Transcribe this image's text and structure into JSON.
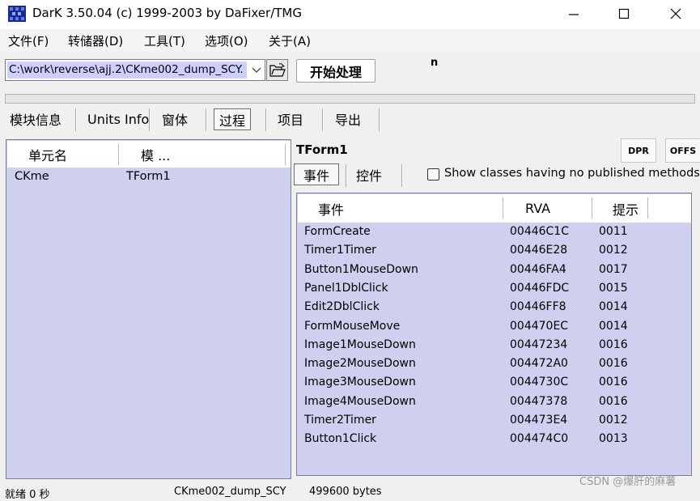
{
  "window": {
    "title": "DarK 3.50.04 (c) 1999-2003 by DaFixer/TMG"
  },
  "menu": [
    "文件(F)",
    "转储器(D)",
    "工具(T)",
    "选项(O)",
    "关于(A)"
  ],
  "toolbar": {
    "path_value": "C:\\work\\reverse\\ajj.2\\CKme002_dump_SCY.",
    "process_label": "开始处理",
    "n_label": "n"
  },
  "tabs": [
    "模块信息",
    "Units Info",
    "窗体",
    "过程",
    "项目",
    "导出"
  ],
  "active_tab": "过程",
  "left_table": {
    "headers": [
      "单元名",
      "模 ..."
    ],
    "rows": [
      {
        "unit": "CKme",
        "module": "TForm1"
      }
    ]
  },
  "right": {
    "form_title": "TForm1",
    "dpr_label": "DPR",
    "offs_label": "OFFS",
    "subtabs": [
      "事件",
      "控件"
    ],
    "checkbox_label": "Show classes having no published methods",
    "checkbox_checked": false
  },
  "events_table": {
    "headers": [
      "事件",
      "RVA",
      "提示"
    ],
    "rows": [
      {
        "event": "FormCreate",
        "rva": "00446C1C",
        "hint": "0011"
      },
      {
        "event": "Timer1Timer",
        "rva": "00446E28",
        "hint": "0012"
      },
      {
        "event": "Button1MouseDown",
        "rva": "00446FA4",
        "hint": "0017"
      },
      {
        "event": "Panel1DblClick",
        "rva": "00446FDC",
        "hint": "0015"
      },
      {
        "event": "Edit2DblClick",
        "rva": "00446FF8",
        "hint": "0014"
      },
      {
        "event": "FormMouseMove",
        "rva": "004470EC",
        "hint": "0014"
      },
      {
        "event": "Image1MouseDown",
        "rva": "00447234",
        "hint": "0016"
      },
      {
        "event": "Image2MouseDown",
        "rva": "004472A0",
        "hint": "0016"
      },
      {
        "event": "Image3MouseDown",
        "rva": "0044730C",
        "hint": "0016"
      },
      {
        "event": "Image4MouseDown",
        "rva": "00447378",
        "hint": "0016"
      },
      {
        "event": "Timer2Timer",
        "rva": "004473E4",
        "hint": "0012"
      },
      {
        "event": "Button1Click",
        "rva": "004474C0",
        "hint": "0013"
      }
    ]
  },
  "status": {
    "left": "就绪 0 秒",
    "middle": "CKme002_dump_SCY",
    "right": "499600 bytes"
  },
  "watermark": "CSDN @爆肝的麻薯",
  "colors": {
    "list_background": "#cfcfef",
    "selection": "#cfcfff"
  },
  "icons": [
    "app-icon",
    "minimize-icon",
    "maximize-icon",
    "close-icon",
    "chevron-down-icon",
    "open-folder-icon"
  ]
}
